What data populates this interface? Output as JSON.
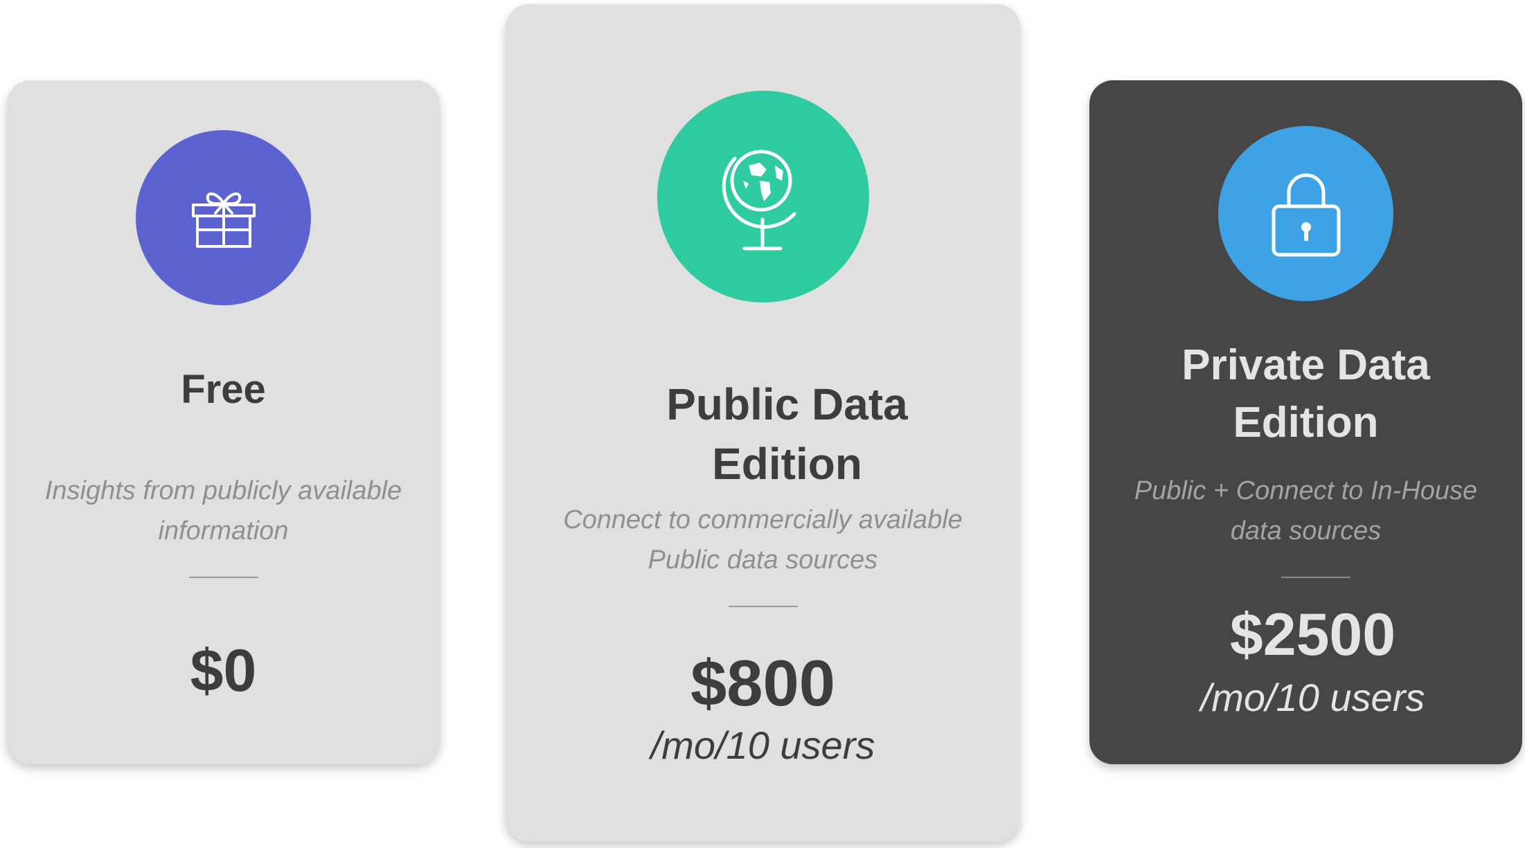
{
  "colors": {
    "card_light": "#e0e0e1",
    "card_dark": "#464646",
    "free_accent": "#5c63d1",
    "public_accent": "#2ecba1",
    "private_accent": "#3da3e6"
  },
  "plans": {
    "free": {
      "icon": "gift-icon",
      "title": "Free",
      "description": "Insights from publicly available information",
      "price": "$0"
    },
    "public": {
      "icon": "globe-icon",
      "title": "Public Data\nEdition",
      "description": "Connect to commercially available Public data sources",
      "price": "$800",
      "per": "/mo/10 users"
    },
    "private": {
      "icon": "lock-icon",
      "title": "Private Data\nEdition",
      "description": "Public + Connect to In-House data sources",
      "price": "$2500",
      "per": "/mo/10 users"
    }
  }
}
